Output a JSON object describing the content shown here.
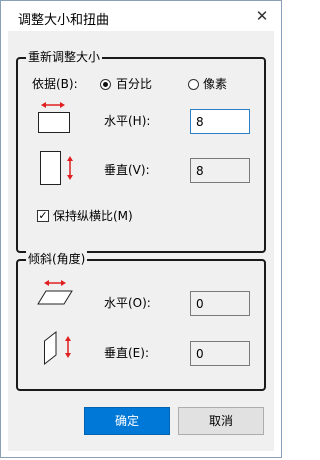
{
  "window": {
    "title": "调整大小和扭曲",
    "close_glyph": "✕"
  },
  "resize": {
    "group_title": "重新调整大小",
    "basis_label": "依据(B):",
    "percent_label": "百分比",
    "pixels_label": "像素",
    "selected": "percent",
    "horizontal_label": "水平(H):",
    "horizontal_value": "8",
    "vertical_label": "垂直(V):",
    "vertical_value": "8",
    "keep_ratio_label": "保持纵横比(M)",
    "keep_ratio_checked": true
  },
  "skew": {
    "group_title": "倾斜(角度)",
    "horizontal_label": "水平(O):",
    "horizontal_value": "0",
    "vertical_label": "垂直(E):",
    "vertical_value": "0"
  },
  "buttons": {
    "ok": "确定",
    "cancel": "取消"
  },
  "colors": {
    "accent": "#0078d7",
    "arrow": "#e02020",
    "focus_border": "#2d7dc8"
  }
}
